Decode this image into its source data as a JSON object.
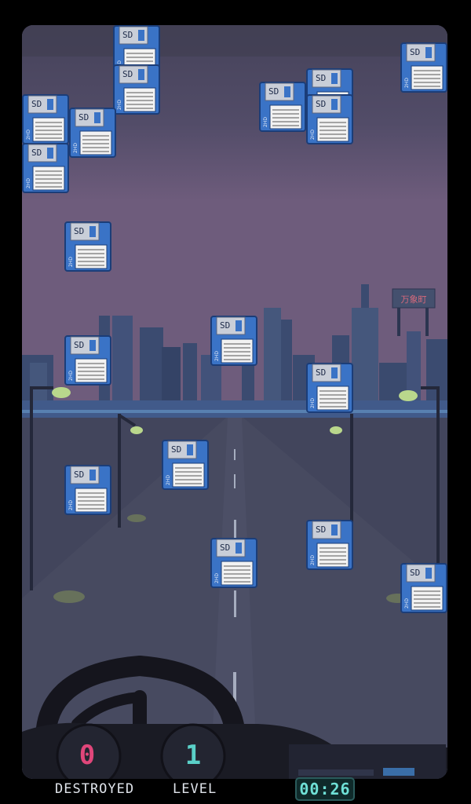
{
  "hud": {
    "destroyed_label": "DESTROYED",
    "destroyed_count": "0",
    "level_label": "LEVEL",
    "level_value": "1",
    "timer": "00:26"
  },
  "billboard_text": "万象町",
  "floppy": {
    "brand": "SD",
    "side_label": "2HD",
    "count": 17
  },
  "colors": {
    "sky_top": "#4a465e",
    "sky_bottom": "#6b5a7a",
    "city": "#3a4a6e",
    "road": "#474a60",
    "floppy_blue": "#3a73c6",
    "destroyed_digit": "#e0467a",
    "level_digit": "#5ad0c8"
  }
}
